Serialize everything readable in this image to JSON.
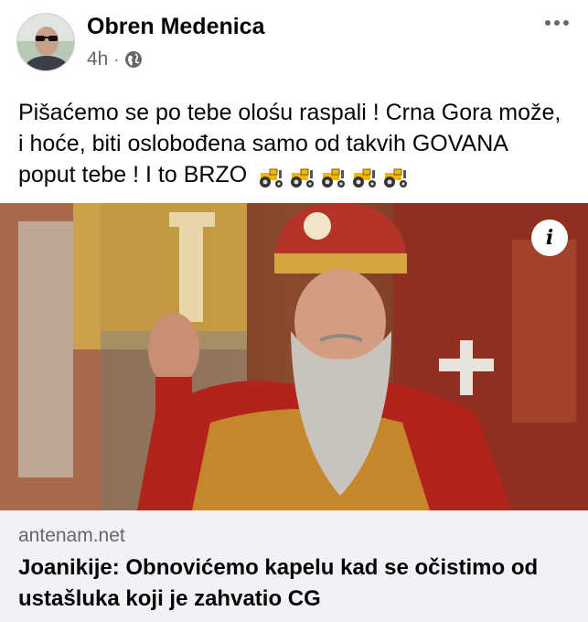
{
  "post": {
    "author": "Obren Medenica",
    "time": "4h",
    "separator": "·",
    "privacy_icon": "globe-icon",
    "more_icon": "more-dots-icon",
    "text": "Pišaćemo se po tebe olośu raspali ! Crna Gora može, i hoće, biti oslobođena samo od takvih GOVANA poput tebe ! I to BRZO",
    "emoji": [
      "tractor-emoji",
      "tractor-emoji",
      "tractor-emoji",
      "tractor-emoji",
      "tractor-emoji"
    ]
  },
  "link": {
    "info_label": "i",
    "domain": "antenam.net",
    "title": "Joanikije: Obnovićemo kapelu kad se očistimo od ustašluka koji je zahvatio CG"
  },
  "colors": {
    "text": "#050505",
    "secondary": "#65676b",
    "link_bg": "#f0f2f5"
  }
}
